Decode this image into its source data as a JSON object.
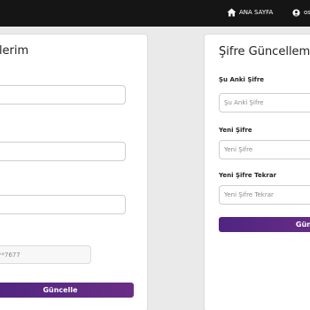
{
  "nav": {
    "home_label": "ANA SAYFA",
    "user_label": "os"
  },
  "profile_card": {
    "title": "lerim",
    "phone_value": "****7677",
    "update_button": "Güncelle"
  },
  "password_card": {
    "title": "Şifre Güncellem",
    "current_label": "Şu Anki Şifre",
    "current_placeholder": "Şu Anki Şifre",
    "new_label": "Yeni Şifre",
    "new_placeholder": "Yeni Şifre",
    "repeat_label": "Yeni Şifre Tekrar",
    "repeat_placeholder": "Yeni Şifre Tekrar",
    "update_button": "Günce"
  },
  "colors": {
    "topbar": "#151515",
    "button": "#5b2a84",
    "background": "#eaeaea"
  }
}
